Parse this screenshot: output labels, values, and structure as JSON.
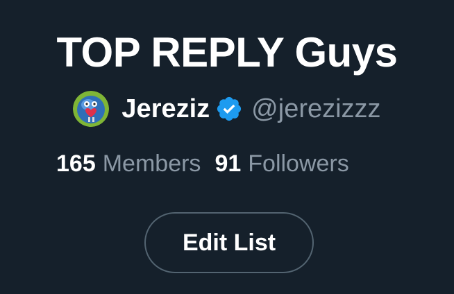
{
  "list": {
    "title": "TOP REPLY Guys"
  },
  "owner": {
    "avatar_icon": "cartoon-avatar-icon",
    "name": "Jereziz",
    "verified_icon": "verified-badge-icon",
    "handle": "@jerezizzz"
  },
  "stats": {
    "members_count": "165",
    "members_label": "Members",
    "followers_count": "91",
    "followers_label": "Followers"
  },
  "actions": {
    "edit_label": "Edit List"
  },
  "colors": {
    "background": "#15202b",
    "primary_text": "#ffffff",
    "secondary_text": "#8b98a5",
    "verified_blue": "#1d9bf0",
    "button_border": "#536471"
  }
}
